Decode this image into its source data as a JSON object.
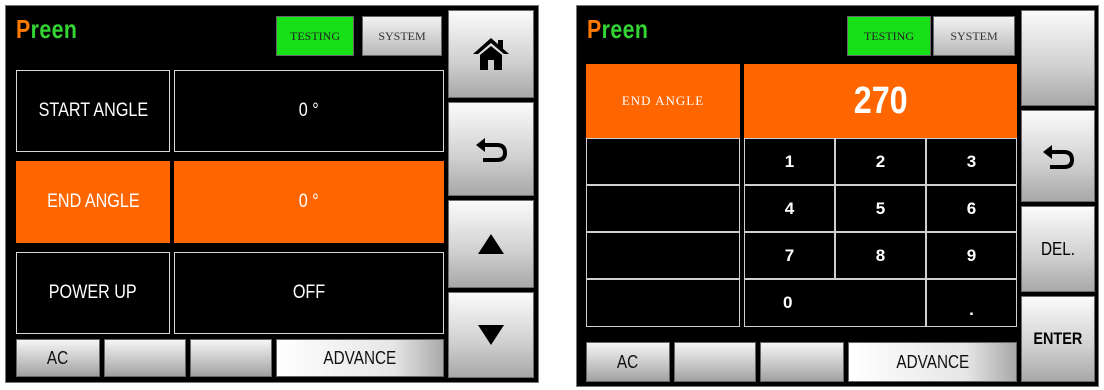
{
  "brand": {
    "first": "P",
    "rest": "reen"
  },
  "tabs": {
    "testing": "TESTING",
    "system": "SYSTEM"
  },
  "screen1": {
    "rows": [
      {
        "label": "START ANGLE",
        "value": "0 °",
        "selected": false
      },
      {
        "label": "END ANGLE",
        "value": "0 °",
        "selected": true
      },
      {
        "label": "POWER UP",
        "value": "OFF",
        "selected": false
      }
    ],
    "bottom": {
      "ac": "AC",
      "advance": "ADVANCE"
    },
    "side_icons": [
      "home-icon",
      "back-arrow-icon",
      "up-arrow-icon",
      "down-arrow-icon"
    ]
  },
  "screen2": {
    "field_label": "END ANGLE",
    "entry_value": "270",
    "keys": [
      "1",
      "2",
      "3",
      "4",
      "5",
      "6",
      "7",
      "8",
      "9",
      "0",
      "."
    ],
    "side": {
      "del": "DEL.",
      "enter": "ENTER"
    },
    "bottom": {
      "ac": "AC",
      "advance": "ADVANCE"
    }
  },
  "colors": {
    "accent": "#ff6600",
    "active_tab": "#18e018",
    "logo_p": "#ff7a00",
    "logo_rest": "#33d433"
  }
}
